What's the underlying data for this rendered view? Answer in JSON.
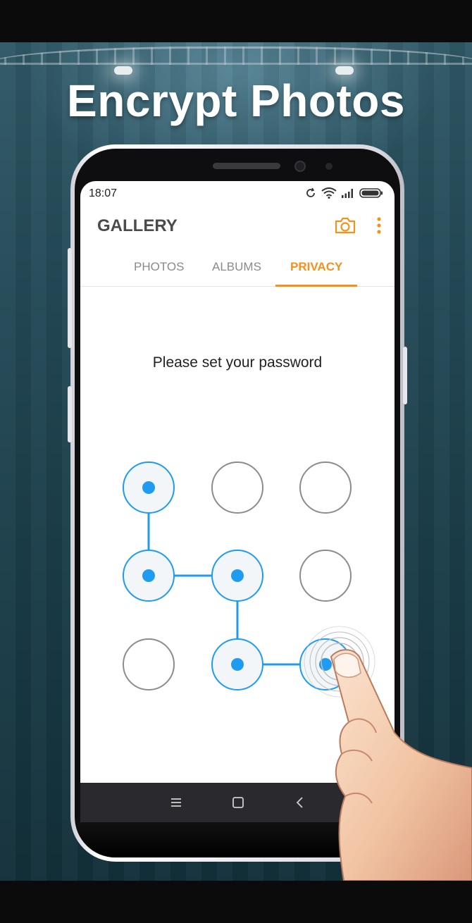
{
  "headline": "Encrypt Photos",
  "status_bar": {
    "time": "18:07"
  },
  "app": {
    "title": "GALLERY",
    "tabs": [
      {
        "label": "PHOTOS",
        "active": false
      },
      {
        "label": "ALBUMS",
        "active": false
      },
      {
        "label": "PRIVACY",
        "active": true
      }
    ]
  },
  "lock_screen": {
    "prompt": "Please set your password",
    "pattern_sequence": [
      1,
      4,
      5,
      8,
      9
    ],
    "grid_size": 3
  },
  "colors": {
    "accent": "#f39219",
    "pattern_blue": "#1f9bef",
    "background_teal": "#244a57"
  },
  "icons": {
    "camera": "camera-icon",
    "more": "more-vert-icon",
    "nav_recents": "menu-icon",
    "nav_home": "square-icon",
    "nav_back": "chevron-left-icon"
  }
}
